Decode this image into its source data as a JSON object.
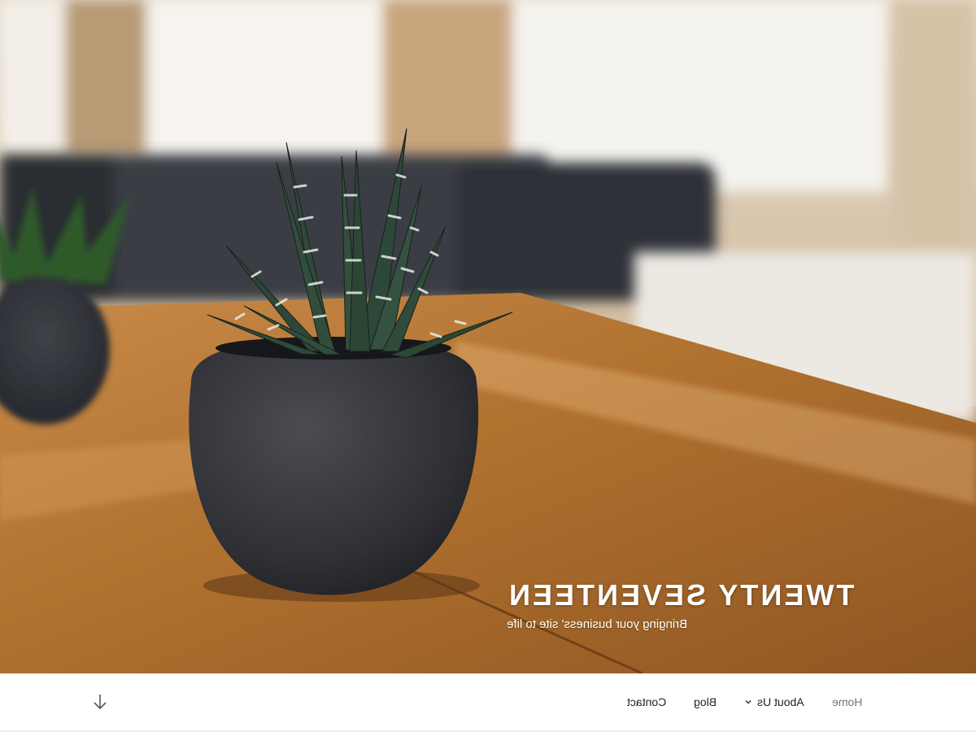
{
  "site": {
    "title": "TWENTY SEVENTEEN",
    "description": "Bringing your business' site to life"
  },
  "hero": {
    "image": "desk-succulent-plant-photo"
  },
  "nav": {
    "items": [
      {
        "label": "Home",
        "current": true
      },
      {
        "label": "About Us",
        "has_submenu": true
      },
      {
        "label": "Blog"
      },
      {
        "label": "Contact"
      }
    ],
    "scroll_icon": "arrow-down-icon"
  },
  "colors": {
    "text_dark": "#222222",
    "text_muted": "#767676",
    "header_text": "#ffffff"
  }
}
